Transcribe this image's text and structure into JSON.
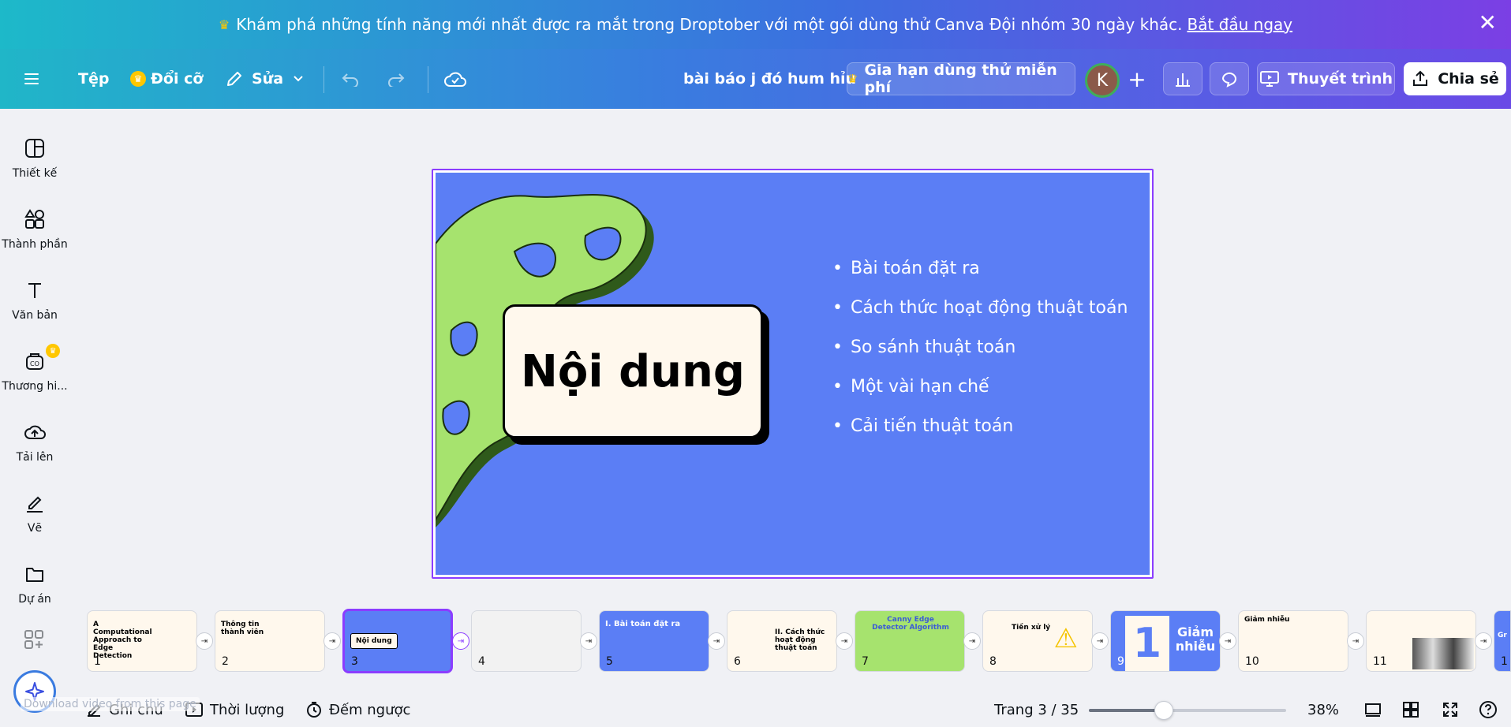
{
  "banner": {
    "text": "Khám phá những tính năng mới nhất được ra mắt trong Droptober với một gói dùng thử Canva Đội nhóm 30 ngày khác.",
    "link": "Bắt đầu ngay",
    "close": "✕"
  },
  "topbar": {
    "file": "Tệp",
    "resize": "Đổi cỡ",
    "edit": "Sửa",
    "doc_title": "bài báo j đó hum hỉu",
    "trial": "Gia hạn dùng thử miễn phí",
    "avatar_initial": "K",
    "present": "Thuyết trình",
    "share": "Chia sẻ"
  },
  "sidebar": {
    "items": [
      {
        "label": "Thiết kế"
      },
      {
        "label": "Thành phần"
      },
      {
        "label": "Văn bản"
      },
      {
        "label": "Thương hi..."
      },
      {
        "label": "Tải lên"
      },
      {
        "label": "Vẽ"
      },
      {
        "label": "Dự án"
      }
    ]
  },
  "slide": {
    "title": "Nội dung",
    "bullets": [
      "Bài toán đặt ra",
      "Cách thức hoạt động thuật toán",
      "So sánh thuật toán",
      "Một vài hạn chế",
      "Cải tiến thuật toán"
    ]
  },
  "filmstrip": {
    "thumbs": [
      {
        "num": "1",
        "label": "A Computational Approach to Edge Detection",
        "bg": "#fff8ed"
      },
      {
        "num": "2",
        "label": "Thông tin thành viên",
        "bg": "#fff8ed"
      },
      {
        "num": "3",
        "label": "Nội dung",
        "bg": "#5b7ef5"
      },
      {
        "num": "4",
        "label": "",
        "bg": "#f2f2f2"
      },
      {
        "num": "5",
        "label": "I. Bài toán đặt ra",
        "bg": "#5b7ef5"
      },
      {
        "num": "6",
        "label": "II. Cách thức hoạt động thuật toán",
        "bg": "#fff8ed"
      },
      {
        "num": "7",
        "label": "Canny Edge Detector Algorithm",
        "bg": "#a6e36e"
      },
      {
        "num": "8",
        "label": "Tiền xử lý",
        "bg": "#fff8ed"
      },
      {
        "num": "9",
        "label": "Giảm nhiễu",
        "bg": "#5b7ef5"
      },
      {
        "num": "10",
        "label": "Giảm nhiễu",
        "bg": "#fff8ed"
      },
      {
        "num": "11",
        "label": "",
        "bg": "#fff8ed"
      },
      {
        "num": "1",
        "label": "Gr",
        "bg": "#5b7ef5"
      }
    ]
  },
  "bottombar": {
    "notes": "Ghi chú",
    "duration": "Thời lượng",
    "timer": "Đếm ngược",
    "page": "Trang 3 / 35",
    "zoom": "38%",
    "zoom_fraction": 0.38,
    "overlay": "Download video from this page"
  },
  "colors": {
    "accent": "#8b3dff",
    "slide_bg": "#5b7ef5",
    "blob_green": "#a6e36e",
    "blob_dark": "#2f5a1b"
  }
}
